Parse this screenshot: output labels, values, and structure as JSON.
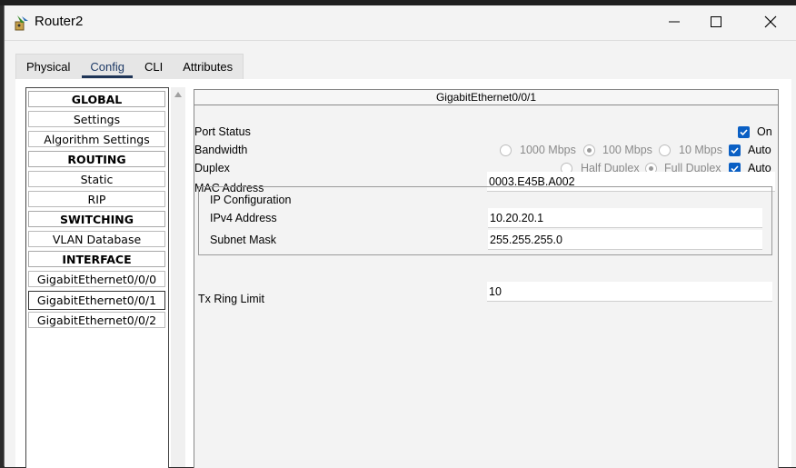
{
  "window": {
    "title": "Router2"
  },
  "tabs": [
    "Physical",
    "Config",
    "CLI",
    "Attributes"
  ],
  "sidebar": {
    "items": [
      {
        "label": "GLOBAL",
        "type": "header"
      },
      {
        "label": "Settings",
        "type": "item"
      },
      {
        "label": "Algorithm Settings",
        "type": "item"
      },
      {
        "label": "ROUTING",
        "type": "header"
      },
      {
        "label": "Static",
        "type": "item"
      },
      {
        "label": "RIP",
        "type": "item"
      },
      {
        "label": "SWITCHING",
        "type": "header"
      },
      {
        "label": "VLAN Database",
        "type": "item"
      },
      {
        "label": "INTERFACE",
        "type": "header"
      },
      {
        "label": "GigabitEthernet0/0/0",
        "type": "item"
      },
      {
        "label": "GigabitEthernet0/0/1",
        "type": "item",
        "selected": true
      },
      {
        "label": "GigabitEthernet0/0/2",
        "type": "item"
      }
    ]
  },
  "interface": {
    "title": "GigabitEthernet0/0/1",
    "port_status": {
      "label": "Port Status",
      "on_label": "On",
      "checked": true
    },
    "bandwidth": {
      "label": "Bandwidth",
      "options": [
        "1000 Mbps",
        "100 Mbps",
        "10 Mbps"
      ],
      "selected": "100 Mbps",
      "auto_label": "Auto",
      "auto_checked": true
    },
    "duplex": {
      "label": "Duplex",
      "options": [
        "Half Duplex",
        "Full Duplex"
      ],
      "selected": "Full Duplex",
      "auto_label": "Auto",
      "auto_checked": true
    },
    "mac": {
      "label": "MAC Address",
      "value": "0003.E45B.A002"
    },
    "ip_config": {
      "label": "IP Configuration",
      "ipv4_label": "IPv4 Address",
      "ipv4_value": "10.20.20.1",
      "mask_label": "Subnet Mask",
      "mask_value": "255.255.255.0"
    },
    "tx_ring": {
      "label": "Tx Ring Limit",
      "value": "10"
    }
  }
}
